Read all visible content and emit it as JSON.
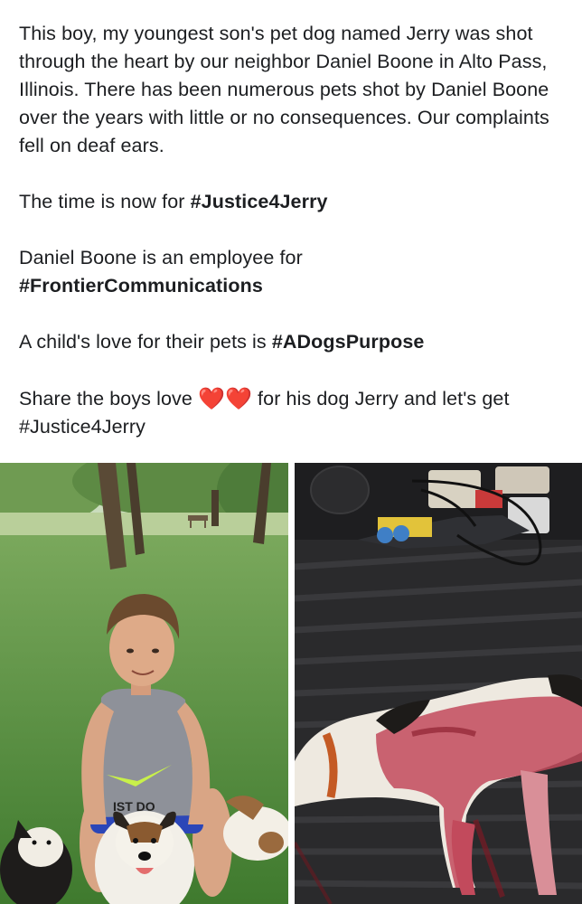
{
  "post": {
    "paragraph_1": "This boy, my youngest son's pet dog named Jerry was shot through the heart by our neighbor Daniel Boone in Alto Pass, Illinois. There has been numerous pets shot by Daniel Boone over the years with little or no consequences. Our complaints fell on deaf ears.",
    "paragraph_2_prefix": "The time is now for ",
    "paragraph_2_hashtag": "#Justice4Jerry",
    "paragraph_3_text": "Daniel Boone is an employee for",
    "paragraph_3_hashtag": "#FrontierCommunications",
    "paragraph_4_prefix": "A child's love for their pets is ",
    "paragraph_4_hashtag": "#ADogsPurpose",
    "paragraph_5_prefix": "Share the boys love ",
    "paragraph_5_hearts": "❤️❤️",
    "paragraph_5_suffix": " for his dog Jerry and let's get #Justice4Jerry"
  },
  "photos": {
    "left_shirt_text": "IST DO"
  },
  "colors": {
    "text": "#1c1e21",
    "heart": "#e0223a",
    "grass": "#4f8a3a",
    "truck_bed": "#2a2a2c"
  }
}
